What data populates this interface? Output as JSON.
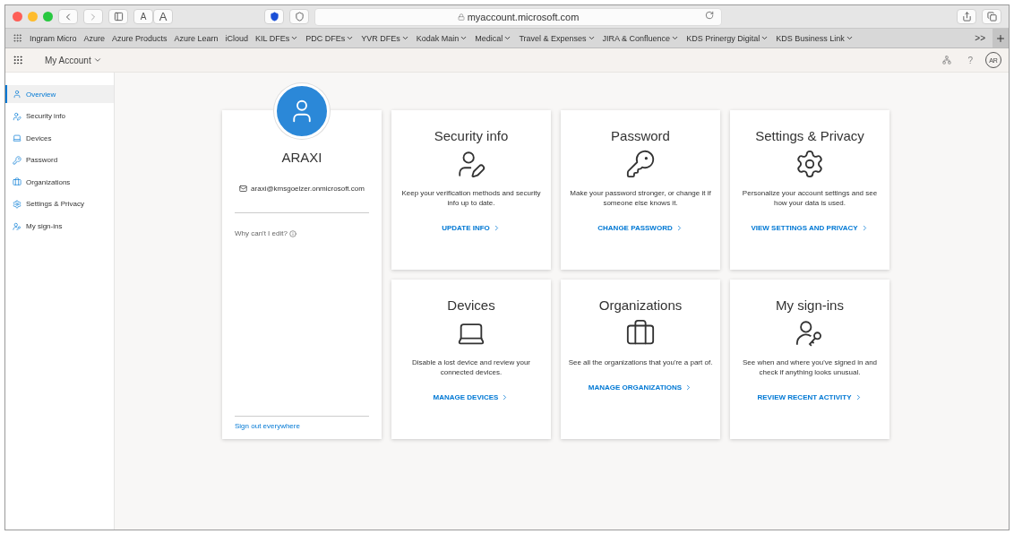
{
  "browser": {
    "font_buttons": [
      "A",
      "A"
    ],
    "address": "myaccount.microsoft.com",
    "bookmarks": [
      {
        "label": "Ingram Micro",
        "menu": false
      },
      {
        "label": "Azure",
        "menu": false
      },
      {
        "label": "Azure Products",
        "menu": false
      },
      {
        "label": "Azure Learn",
        "menu": false
      },
      {
        "label": "iCloud",
        "menu": false
      },
      {
        "label": "KIL DFEs",
        "menu": true
      },
      {
        "label": "PDC DFEs",
        "menu": true
      },
      {
        "label": "YVR DFEs",
        "menu": true
      },
      {
        "label": "Kodak Main",
        "menu": true
      },
      {
        "label": "Medical",
        "menu": true
      },
      {
        "label": "Travel & Expenses",
        "menu": true
      },
      {
        "label": "JIRA & Confluence",
        "menu": true
      },
      {
        "label": "KDS Prinergy Digital",
        "menu": true
      },
      {
        "label": "KDS Business Link",
        "menu": true
      }
    ],
    "overflow": ">>"
  },
  "header": {
    "title": "My Account",
    "help": "?",
    "avatar": "AR"
  },
  "sidebar": {
    "items": [
      {
        "label": "Overview",
        "kind": "overview",
        "selected": true
      },
      {
        "label": "Security info",
        "kind": "security",
        "selected": false
      },
      {
        "label": "Devices",
        "kind": "devices",
        "selected": false
      },
      {
        "label": "Password",
        "kind": "password",
        "selected": false
      },
      {
        "label": "Organizations",
        "kind": "organizations",
        "selected": false
      },
      {
        "label": "Settings & Privacy",
        "kind": "settings",
        "selected": false
      },
      {
        "label": "My sign-ins",
        "kind": "signins",
        "selected": false
      }
    ]
  },
  "profile": {
    "name": "ARAXI",
    "email": "araxi@kmsgoelzer.onmicrosoft.com",
    "why": "Why can't I edit?",
    "sign_out": "Sign out everywhere"
  },
  "tiles": [
    {
      "kind": "security",
      "title": "Security info",
      "text": "Keep your verification methods and security info up to date.",
      "link": "UPDATE INFO"
    },
    {
      "kind": "password",
      "title": "Password",
      "text": "Make your password stronger, or change it if someone else knows it.",
      "link": "CHANGE PASSWORD"
    },
    {
      "kind": "settings",
      "title": "Settings & Privacy",
      "text": "Personalize your account settings and see how your data is used.",
      "link": "VIEW SETTINGS AND PRIVACY"
    },
    {
      "kind": "devices",
      "title": "Devices",
      "text": "Disable a lost device and review your connected devices.",
      "link": "MANAGE DEVICES"
    },
    {
      "kind": "organizations",
      "title": "Organizations",
      "text": "See all the organizations that you're a part of.",
      "link": "MANAGE ORGANIZATIONS"
    },
    {
      "kind": "signins",
      "title": "My sign-ins",
      "text": "See when and where you've signed in and check if anything looks unusual.",
      "link": "REVIEW RECENT ACTIVITY"
    }
  ]
}
